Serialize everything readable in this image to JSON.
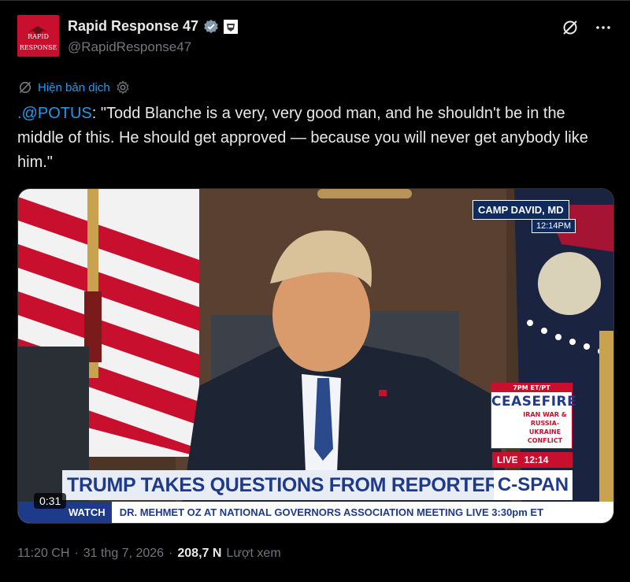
{
  "author": {
    "display_name": "Rapid Response 47",
    "handle": "@RapidResponse47",
    "avatar_text_line1": "RAPID",
    "avatar_text_line2": "RESPONSE"
  },
  "translate": {
    "label": "Hiện bản dịch"
  },
  "post": {
    "mention": ".@POTUS",
    "body": ": \"Todd Blanche is a very, very good man, and he shouldn't be in the middle of this. He should get approved — because you will never get anybody like him.\""
  },
  "video": {
    "location": "CAMP DAVID, MD",
    "time": "12:14",
    "time_suffix": "PM",
    "cf_top": "7PM ET/PT",
    "cf_title": "CEASEFIRE",
    "cf_sub": "IRAN WAR & RUSSIA-UKRAINE CONFLICT",
    "live_label": "LIVE",
    "live_time": "12:14",
    "headline": "TRUMP TAKES QUESTIONS FROM REPORTERS",
    "network": "C-SPAN",
    "ticker_tag": "WATCH",
    "ticker_text": "DR. MEHMET OZ AT NATIONAL GOVERNORS ASSOCIATION MEETING   LIVE 3:30pm ET",
    "duration": "0:31"
  },
  "meta": {
    "time": "11:20 CH",
    "date": "31 thg 7, 2026",
    "views": "208,7 N",
    "views_label": "Lượt xem",
    "separator": "·"
  },
  "colors": {
    "accent": "#1d9bf0",
    "background": "#000000",
    "muted": "#71767b"
  }
}
